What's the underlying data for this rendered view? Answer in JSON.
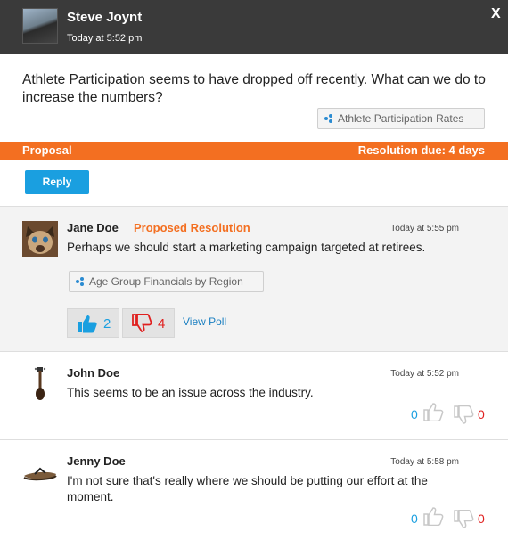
{
  "header": {
    "author": "Steve Joynt",
    "time": "Today at 5:52 pm",
    "close_label": "X"
  },
  "question": {
    "text": "Athlete Participation seems to have dropped off recently. What can we do to increase the numbers?",
    "tag": "Athlete Participation Rates"
  },
  "proposal_bar": {
    "left": "Proposal",
    "right": "Resolution due: 4 days"
  },
  "reply_label": "Reply",
  "comments": [
    {
      "author": "Jane Doe",
      "label": "Proposed Resolution",
      "time": "Today at 5:55 pm",
      "text": "Perhaps we should start a marketing campaign targeted at retirees.",
      "tag": "Age Group Financials by Region",
      "up": "2",
      "down": "4",
      "poll_label": "View Poll"
    },
    {
      "author": "John Doe",
      "time": "Today at 5:52 pm",
      "text": "This seems to be an issue across the industry.",
      "up": "0",
      "down": "0"
    },
    {
      "author": "Jenny Doe",
      "time": "Today at 5:58 pm",
      "text": "I'm not sure that's really where we should be putting our effort at the moment.",
      "up": "0",
      "down": "0"
    }
  ],
  "colors": {
    "accent": "#f36f21",
    "button": "#1a9fe0",
    "up": "#1a9fe0",
    "down": "#e0201f"
  }
}
